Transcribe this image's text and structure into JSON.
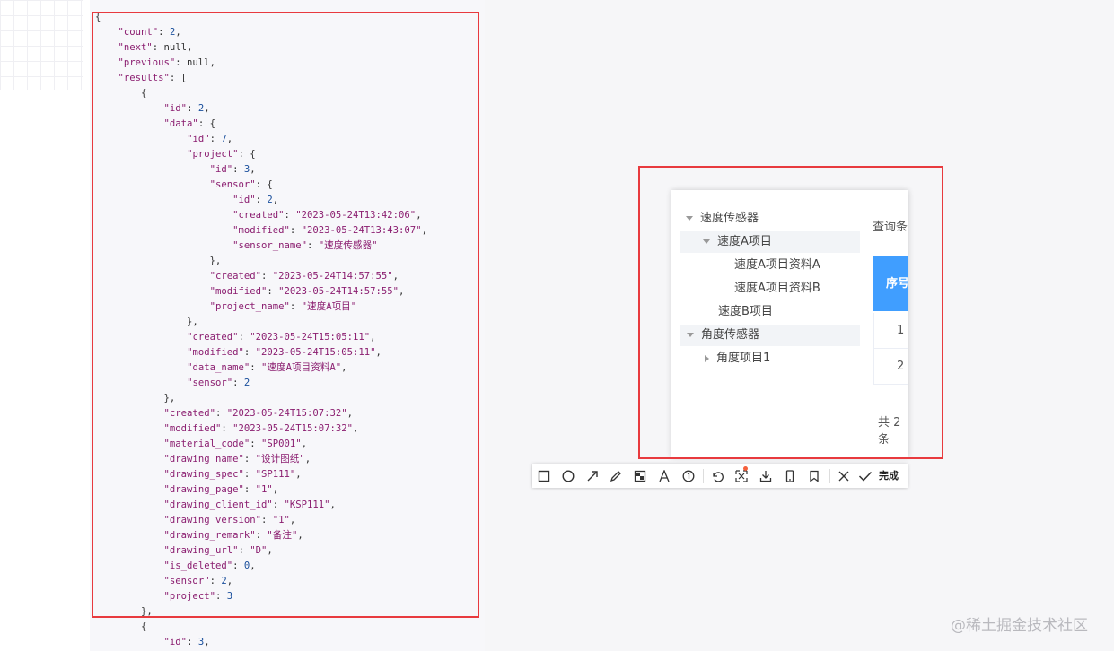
{
  "json_view": {
    "lines": [
      [
        {
          "t": "p",
          "v": "{"
        }
      ],
      [
        {
          "t": "p",
          "v": "    "
        },
        {
          "t": "k",
          "v": "\"count\""
        },
        {
          "t": "p",
          "v": ": "
        },
        {
          "t": "n",
          "v": "2"
        },
        {
          "t": "p",
          "v": ","
        }
      ],
      [
        {
          "t": "p",
          "v": "    "
        },
        {
          "t": "k",
          "v": "\"next\""
        },
        {
          "t": "p",
          "v": ": null,"
        }
      ],
      [
        {
          "t": "p",
          "v": "    "
        },
        {
          "t": "k",
          "v": "\"previous\""
        },
        {
          "t": "p",
          "v": ": null,"
        }
      ],
      [
        {
          "t": "p",
          "v": "    "
        },
        {
          "t": "k",
          "v": "\"results\""
        },
        {
          "t": "p",
          "v": ": ["
        }
      ],
      [
        {
          "t": "p",
          "v": "        {"
        }
      ],
      [
        {
          "t": "p",
          "v": "            "
        },
        {
          "t": "k",
          "v": "\"id\""
        },
        {
          "t": "p",
          "v": ": "
        },
        {
          "t": "n",
          "v": "2"
        },
        {
          "t": "p",
          "v": ","
        }
      ],
      [
        {
          "t": "p",
          "v": "            "
        },
        {
          "t": "k",
          "v": "\"data\""
        },
        {
          "t": "p",
          "v": ": {"
        }
      ],
      [
        {
          "t": "p",
          "v": "                "
        },
        {
          "t": "k",
          "v": "\"id\""
        },
        {
          "t": "p",
          "v": ": "
        },
        {
          "t": "n",
          "v": "7"
        },
        {
          "t": "p",
          "v": ","
        }
      ],
      [
        {
          "t": "p",
          "v": "                "
        },
        {
          "t": "k",
          "v": "\"project\""
        },
        {
          "t": "p",
          "v": ": {"
        }
      ],
      [
        {
          "t": "p",
          "v": "                    "
        },
        {
          "t": "k",
          "v": "\"id\""
        },
        {
          "t": "p",
          "v": ": "
        },
        {
          "t": "n",
          "v": "3"
        },
        {
          "t": "p",
          "v": ","
        }
      ],
      [
        {
          "t": "p",
          "v": "                    "
        },
        {
          "t": "k",
          "v": "\"sensor\""
        },
        {
          "t": "p",
          "v": ": {"
        }
      ],
      [
        {
          "t": "p",
          "v": "                        "
        },
        {
          "t": "k",
          "v": "\"id\""
        },
        {
          "t": "p",
          "v": ": "
        },
        {
          "t": "n",
          "v": "2"
        },
        {
          "t": "p",
          "v": ","
        }
      ],
      [
        {
          "t": "p",
          "v": "                        "
        },
        {
          "t": "k",
          "v": "\"created\""
        },
        {
          "t": "p",
          "v": ": "
        },
        {
          "t": "s",
          "v": "\"2023-05-24T13:42:06\""
        },
        {
          "t": "p",
          "v": ","
        }
      ],
      [
        {
          "t": "p",
          "v": "                        "
        },
        {
          "t": "k",
          "v": "\"modified\""
        },
        {
          "t": "p",
          "v": ": "
        },
        {
          "t": "s",
          "v": "\"2023-05-24T13:43:07\""
        },
        {
          "t": "p",
          "v": ","
        }
      ],
      [
        {
          "t": "p",
          "v": "                        "
        },
        {
          "t": "k",
          "v": "\"sensor_name\""
        },
        {
          "t": "p",
          "v": ": "
        },
        {
          "t": "s",
          "v": "\"速度传感器\""
        }
      ],
      [
        {
          "t": "p",
          "v": "                    },"
        }
      ],
      [
        {
          "t": "p",
          "v": "                    "
        },
        {
          "t": "k",
          "v": "\"created\""
        },
        {
          "t": "p",
          "v": ": "
        },
        {
          "t": "s",
          "v": "\"2023-05-24T14:57:55\""
        },
        {
          "t": "p",
          "v": ","
        }
      ],
      [
        {
          "t": "p",
          "v": "                    "
        },
        {
          "t": "k",
          "v": "\"modified\""
        },
        {
          "t": "p",
          "v": ": "
        },
        {
          "t": "s",
          "v": "\"2023-05-24T14:57:55\""
        },
        {
          "t": "p",
          "v": ","
        }
      ],
      [
        {
          "t": "p",
          "v": "                    "
        },
        {
          "t": "k",
          "v": "\"project_name\""
        },
        {
          "t": "p",
          "v": ": "
        },
        {
          "t": "s",
          "v": "\"速度A项目\""
        }
      ],
      [
        {
          "t": "p",
          "v": "                },"
        }
      ],
      [
        {
          "t": "p",
          "v": "                "
        },
        {
          "t": "k",
          "v": "\"created\""
        },
        {
          "t": "p",
          "v": ": "
        },
        {
          "t": "s",
          "v": "\"2023-05-24T15:05:11\""
        },
        {
          "t": "p",
          "v": ","
        }
      ],
      [
        {
          "t": "p",
          "v": "                "
        },
        {
          "t": "k",
          "v": "\"modified\""
        },
        {
          "t": "p",
          "v": ": "
        },
        {
          "t": "s",
          "v": "\"2023-05-24T15:05:11\""
        },
        {
          "t": "p",
          "v": ","
        }
      ],
      [
        {
          "t": "p",
          "v": "                "
        },
        {
          "t": "k",
          "v": "\"data_name\""
        },
        {
          "t": "p",
          "v": ": "
        },
        {
          "t": "s",
          "v": "\"速度A项目资料A\""
        },
        {
          "t": "p",
          "v": ","
        }
      ],
      [
        {
          "t": "p",
          "v": "                "
        },
        {
          "t": "k",
          "v": "\"sensor\""
        },
        {
          "t": "p",
          "v": ": "
        },
        {
          "t": "n",
          "v": "2"
        }
      ],
      [
        {
          "t": "p",
          "v": "            },"
        }
      ],
      [
        {
          "t": "p",
          "v": "            "
        },
        {
          "t": "k",
          "v": "\"created\""
        },
        {
          "t": "p",
          "v": ": "
        },
        {
          "t": "s",
          "v": "\"2023-05-24T15:07:32\""
        },
        {
          "t": "p",
          "v": ","
        }
      ],
      [
        {
          "t": "p",
          "v": "            "
        },
        {
          "t": "k",
          "v": "\"modified\""
        },
        {
          "t": "p",
          "v": ": "
        },
        {
          "t": "s",
          "v": "\"2023-05-24T15:07:32\""
        },
        {
          "t": "p",
          "v": ","
        }
      ],
      [
        {
          "t": "p",
          "v": "            "
        },
        {
          "t": "k",
          "v": "\"material_code\""
        },
        {
          "t": "p",
          "v": ": "
        },
        {
          "t": "s",
          "v": "\"SP001\""
        },
        {
          "t": "p",
          "v": ","
        }
      ],
      [
        {
          "t": "p",
          "v": "            "
        },
        {
          "t": "k",
          "v": "\"drawing_name\""
        },
        {
          "t": "p",
          "v": ": "
        },
        {
          "t": "s",
          "v": "\"设计图纸\""
        },
        {
          "t": "p",
          "v": ","
        }
      ],
      [
        {
          "t": "p",
          "v": "            "
        },
        {
          "t": "k",
          "v": "\"drawing_spec\""
        },
        {
          "t": "p",
          "v": ": "
        },
        {
          "t": "s",
          "v": "\"SP111\""
        },
        {
          "t": "p",
          "v": ","
        }
      ],
      [
        {
          "t": "p",
          "v": "            "
        },
        {
          "t": "k",
          "v": "\"drawing_page\""
        },
        {
          "t": "p",
          "v": ": "
        },
        {
          "t": "s",
          "v": "\"1\""
        },
        {
          "t": "p",
          "v": ","
        }
      ],
      [
        {
          "t": "p",
          "v": "            "
        },
        {
          "t": "k",
          "v": "\"drawing_client_id\""
        },
        {
          "t": "p",
          "v": ": "
        },
        {
          "t": "s",
          "v": "\"KSP111\""
        },
        {
          "t": "p",
          "v": ","
        }
      ],
      [
        {
          "t": "p",
          "v": "            "
        },
        {
          "t": "k",
          "v": "\"drawing_version\""
        },
        {
          "t": "p",
          "v": ": "
        },
        {
          "t": "s",
          "v": "\"1\""
        },
        {
          "t": "p",
          "v": ","
        }
      ],
      [
        {
          "t": "p",
          "v": "            "
        },
        {
          "t": "k",
          "v": "\"drawing_remark\""
        },
        {
          "t": "p",
          "v": ": "
        },
        {
          "t": "s",
          "v": "\"备注\""
        },
        {
          "t": "p",
          "v": ","
        }
      ],
      [
        {
          "t": "p",
          "v": "            "
        },
        {
          "t": "k",
          "v": "\"drawing_url\""
        },
        {
          "t": "p",
          "v": ": "
        },
        {
          "t": "s",
          "v": "\"D\""
        },
        {
          "t": "p",
          "v": ","
        }
      ],
      [
        {
          "t": "p",
          "v": "            "
        },
        {
          "t": "k",
          "v": "\"is_deleted\""
        },
        {
          "t": "p",
          "v": ": "
        },
        {
          "t": "n",
          "v": "0"
        },
        {
          "t": "p",
          "v": ","
        }
      ],
      [
        {
          "t": "p",
          "v": "            "
        },
        {
          "t": "k",
          "v": "\"sensor\""
        },
        {
          "t": "p",
          "v": ": "
        },
        {
          "t": "n",
          "v": "2"
        },
        {
          "t": "p",
          "v": ","
        }
      ],
      [
        {
          "t": "p",
          "v": "            "
        },
        {
          "t": "k",
          "v": "\"project\""
        },
        {
          "t": "p",
          "v": ": "
        },
        {
          "t": "n",
          "v": "3"
        }
      ],
      [
        {
          "t": "p",
          "v": "        },"
        }
      ],
      [
        {
          "t": "p",
          "v": "        {"
        }
      ],
      [
        {
          "t": "p",
          "v": "            "
        },
        {
          "t": "k",
          "v": "\"id\""
        },
        {
          "t": "p",
          "v": ": "
        },
        {
          "t": "n",
          "v": "3"
        },
        {
          "t": "p",
          "v": ","
        }
      ]
    ]
  },
  "tree": {
    "items": [
      {
        "label": "速度传感器",
        "expanded": true
      },
      {
        "label": "速度A项目",
        "expanded": true
      },
      {
        "label": "速度A项目资料A"
      },
      {
        "label": "速度A项目资料B"
      },
      {
        "label": "速度B项目"
      },
      {
        "label": "角度传感器",
        "expanded": true
      },
      {
        "label": "角度项目1",
        "expanded": false
      }
    ]
  },
  "panel": {
    "query_label": "查询条",
    "table_header": "序号",
    "rows": [
      "1",
      "2"
    ],
    "pager_text": "共 2 条"
  },
  "toolbar": {
    "tools": [
      "rectangle-icon",
      "ellipse-icon",
      "arrow-icon",
      "pen-icon",
      "mosaic-icon",
      "text-icon",
      "number-marker-icon",
      "undo-icon",
      "pin-icon",
      "download-icon",
      "mobile-icon",
      "bookmark-icon",
      "close-icon"
    ],
    "done_label": "完成"
  },
  "watermark": "@稀土掘金技术社区",
  "colors": {
    "highlight": "#e83a3e",
    "header": "#409eff"
  }
}
